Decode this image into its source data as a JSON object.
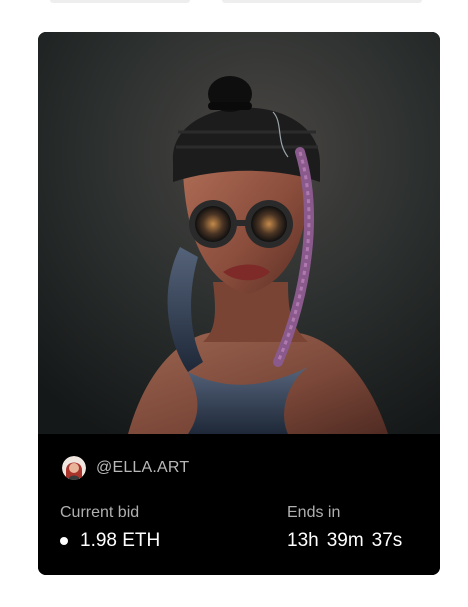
{
  "nft_card": {
    "creator": {
      "handle": "@ELLA.ART"
    },
    "auction": {
      "current_bid_label": "Current bid",
      "current_bid_value": "1.98 ETH",
      "ends_in_label": "Ends in",
      "ends_in": {
        "hours": "13h",
        "minutes": "39m",
        "seconds": "37s"
      }
    },
    "colors": {
      "card_background": "#000000",
      "label_text": "#b0b0b0",
      "value_text": "#ffffff",
      "artwork_backdrop": "#2a302e"
    },
    "icons": [
      "eth-dot-icon",
      "creator-avatar"
    ]
  }
}
